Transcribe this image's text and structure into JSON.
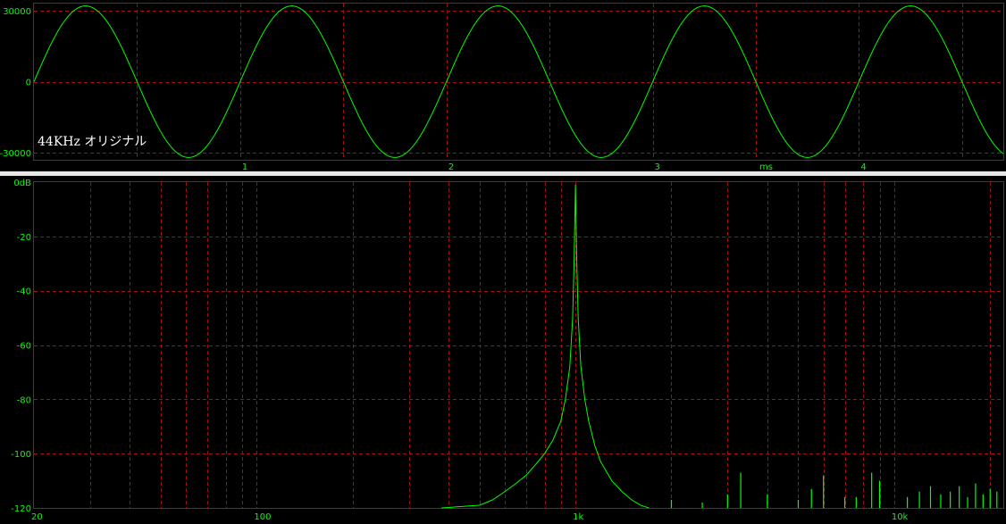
{
  "colors": {
    "background": "#000000",
    "trace": "#00ff00",
    "grid": "#a01010",
    "frame": "#cc0000",
    "separator": "#e8e8e8",
    "caption": "#ffffff"
  },
  "chart_data": [
    {
      "type": "line",
      "caption": "44KHz オリジナル",
      "x_unit_label": "ms",
      "xlim": [
        0,
        4.7
      ],
      "ylim": [
        -33000,
        33000
      ],
      "x_ticks": [
        1,
        2,
        3,
        4
      ],
      "x_tick_labels": [
        "1",
        "2",
        "3",
        "4"
      ],
      "y_ticks": [
        30000,
        0,
        -30000
      ],
      "y_tick_labels": [
        "30000",
        "0",
        "-30000"
      ],
      "grid": true,
      "series": [
        {
          "waveform": "sine",
          "frequency_hz": 1000,
          "amplitude": 32000,
          "sample_rate_hz": 44000
        }
      ]
    },
    {
      "type": "line",
      "x_scale": "log",
      "xlim": [
        20,
        22000
      ],
      "ylim": [
        -120,
        0
      ],
      "x_tick_labels": [
        {
          "value": 20,
          "label": "20"
        },
        {
          "value": 100,
          "label": "100"
        },
        {
          "value": 1000,
          "label": "1k"
        },
        {
          "value": 10000,
          "label": "10k"
        }
      ],
      "y_tick_labels": [
        {
          "value": 0,
          "label": "0dB"
        },
        {
          "value": -20,
          "label": "-20"
        },
        {
          "value": -40,
          "label": "-40"
        },
        {
          "value": -60,
          "label": "-60"
        },
        {
          "value": -80,
          "label": "-80"
        },
        {
          "value": -100,
          "label": "-100"
        },
        {
          "value": -120,
          "label": "-120"
        }
      ],
      "grid": true,
      "series": [
        {
          "x": [
            380,
            500,
            550,
            600,
            650,
            700,
            750,
            800,
            850,
            900,
            930,
            960,
            980,
            990,
            1000,
            1010,
            1020,
            1040,
            1070,
            1100,
            1150,
            1200,
            1300,
            1400,
            1500,
            1600,
            1700
          ],
          "y": [
            -120,
            -119,
            -117,
            -114,
            -111,
            -108,
            -104,
            -100,
            -95,
            -88,
            -80,
            -68,
            -50,
            -30,
            -1,
            -30,
            -50,
            -68,
            -80,
            -88,
            -97,
            -103,
            -110,
            -114,
            -117,
            -119,
            -120
          ]
        },
        {
          "x": [
            2000,
            2500,
            3000,
            3300,
            4000,
            5000,
            5500,
            6000,
            7000,
            7600,
            8500,
            9000,
            11000,
            12000,
            13000,
            14000,
            15000,
            16000,
            17000,
            18000,
            19000,
            20000,
            21000
          ],
          "y": [
            -117,
            -118,
            -115,
            -107,
            -115,
            -117,
            -113,
            -108,
            -116,
            -116,
            -107,
            -110,
            -116,
            -114,
            -112,
            -115,
            -114,
            -112,
            -116,
            -111,
            -115,
            -113,
            -114
          ]
        }
      ]
    }
  ]
}
